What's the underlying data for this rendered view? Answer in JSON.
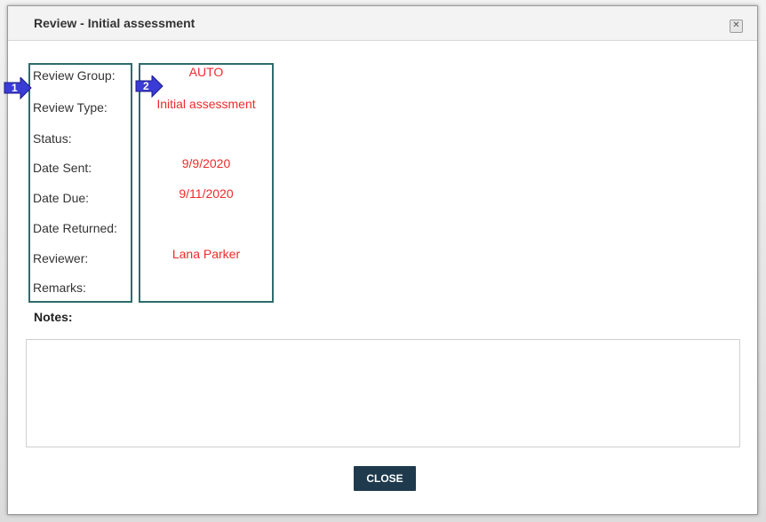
{
  "dialog": {
    "title": "Review - Initial assessment",
    "close_icon": "close-icon"
  },
  "fields": [
    {
      "label": "Review Group:",
      "value": "AUTO"
    },
    {
      "label": "Review Type:",
      "value": "Initial assessment"
    },
    {
      "label": "Status:",
      "value": ""
    },
    {
      "label": "Date Sent:",
      "value": "9/9/2020"
    },
    {
      "label": "Date Due:",
      "value": "9/11/2020"
    },
    {
      "label": "Date Returned:",
      "value": ""
    },
    {
      "label": "Reviewer:",
      "value": "Lana Parker"
    },
    {
      "label": "Remarks:",
      "value": ""
    }
  ],
  "callouts": [
    {
      "number": "1",
      "icon": "callout-arrow-icon"
    },
    {
      "number": "2",
      "icon": "callout-arrow-icon"
    }
  ],
  "notes": {
    "label": "Notes:",
    "value": ""
  },
  "footer": {
    "close_label": "CLOSE"
  },
  "colors": {
    "value_text": "#ee2b2b",
    "highlight_border": "#2e6b6b",
    "callout": "#3b3bd6",
    "close_button": "#1e3a4c"
  }
}
